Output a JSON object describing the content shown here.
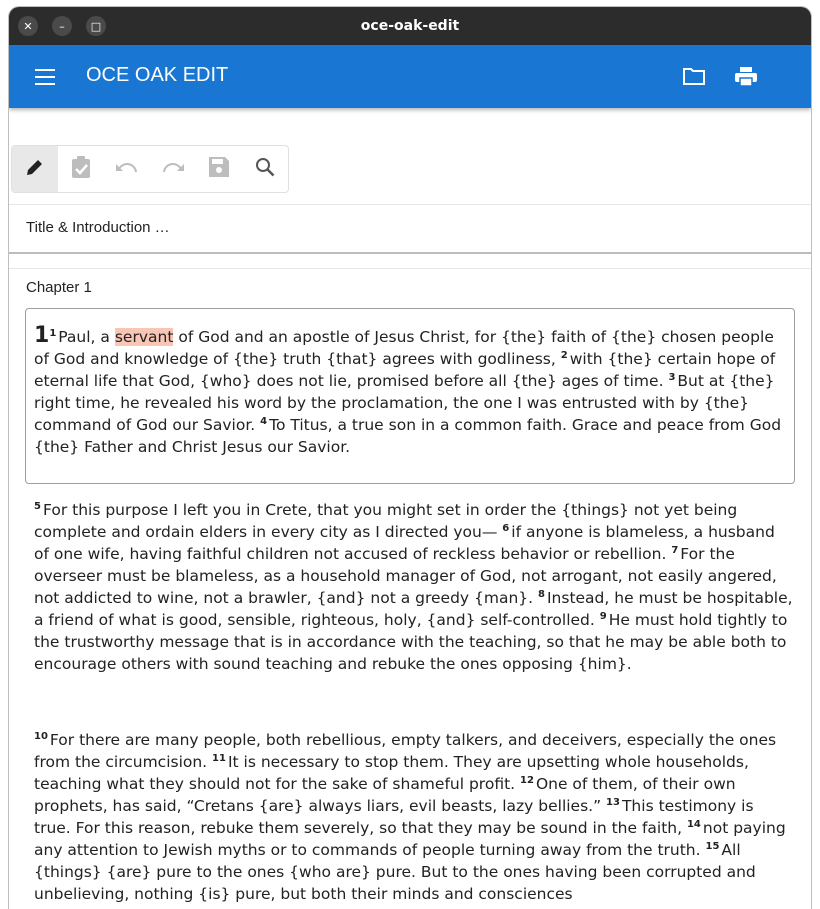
{
  "window": {
    "title": "oce-oak-edit",
    "close": "✕",
    "minimize": "–",
    "maximize": "□"
  },
  "appbar": {
    "title": "OCE OAK EDIT"
  },
  "toolbar": {
    "icons": [
      "pencil-icon",
      "clipboard-check-icon",
      "undo-icon",
      "redo-icon",
      "save-icon",
      "search-icon"
    ]
  },
  "sections": {
    "intro": "Title & Introduction …",
    "chapter": "Chapter 1"
  },
  "paragraph1": {
    "chapter_number": "1",
    "v1_num": "1",
    "v1_pre": "Paul, a ",
    "v1_highlight": "servant",
    "v1_post": " of God and an apostle of Jesus Christ, for {the} faith of {the} chosen people of God and knowledge of {the} truth {that} agrees with godliness, ",
    "v2_num": "2",
    "v2": "with {the} certain hope of eternal life that God, {who} does not lie, promised before all {the} ages of time. ",
    "v3_num": "3",
    "v3": "But at {the} right time, he revealed his word by the proclamation, the one I was entrusted with by {the} command of God our Savior. ",
    "v4_num": "4",
    "v4": "To Titus, a true son in a common faith. Grace and peace from God {the} Father and Christ Jesus our Savior."
  },
  "paragraph2": {
    "v5_num": "5",
    "v5": "For this purpose I left you in Crete, that you might set in order the {things} not yet being complete and ordain elders in every city as I directed you— ",
    "v6_num": "6",
    "v6": "if anyone is blameless, a husband of one wife, having faithful children not accused of reckless behavior or rebellion. ",
    "v7_num": "7",
    "v7": "For the overseer must be blameless, as a household manager of God, not arrogant, not easily angered, not addicted to wine, not a brawler, {and} not a greedy {man}. ",
    "v8_num": "8",
    "v8": "Instead, he must be hospitable, a friend of what is good, sensible, righteous, holy, {and} self-controlled. ",
    "v9_num": "9",
    "v9": "He must hold tightly to the trustworthy message that is in accordance with the teaching, so that he may be able both to encourage others with sound teaching and rebuke the ones opposing {him}."
  },
  "paragraph3": {
    "v10_num": "10",
    "v10": "For there are many people, both rebellious, empty talkers, and deceivers, especially the ones from the circumcision. ",
    "v11_num": "11",
    "v11": "It is necessary to stop them. They are upsetting whole households, teaching what they should not for the sake of shameful profit. ",
    "v12_num": "12",
    "v12": "One of them, of their own prophets, has said, “Cretans {are} always liars, evil beasts, lazy bellies.” ",
    "v13_num": "13",
    "v13": "This testimony is true. For this reason, rebuke them severely, so that they may be sound in the faith, ",
    "v14_num": "14",
    "v14": "not paying any attention to Jewish myths or to commands of people turning away from the truth. ",
    "v15_num": "15",
    "v15": "All {things} {are} pure to the ones {who are} pure. But to the ones having been corrupted and unbelieving, nothing {is} pure, but both their minds and consciences"
  },
  "colors": {
    "appbar": "#1976d2",
    "titlebar": "#2c2c2c",
    "highlight": "#f9c5b4"
  }
}
